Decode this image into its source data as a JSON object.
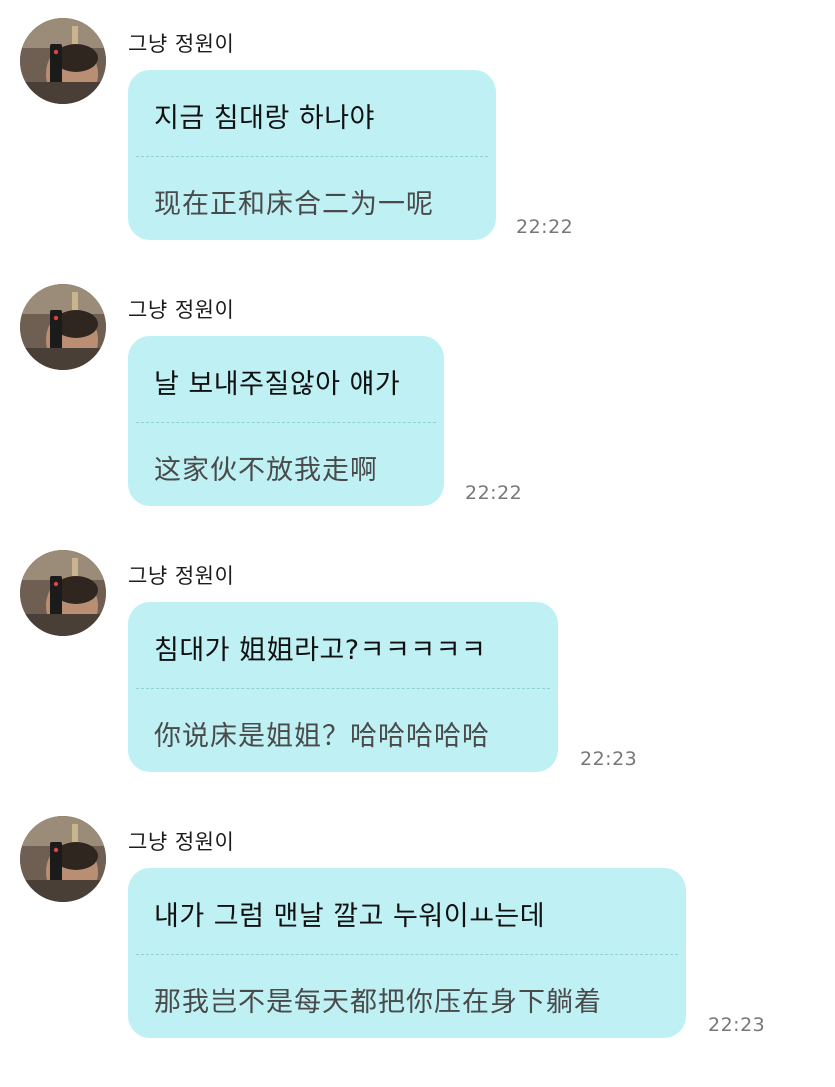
{
  "messages": [
    {
      "sender": "그냥 정원이",
      "text": "지금 침대랑 하나야",
      "translation": "现在正和床合二为一呢",
      "time": "22:22"
    },
    {
      "sender": "그냥 정원이",
      "text": "날 보내주질않아 얘가",
      "translation": "这家伙不放我走啊",
      "time": "22:22"
    },
    {
      "sender": "그냥 정원이",
      "text": "침대가 姐姐라고?ㅋㅋㅋㅋㅋ",
      "translation": "你说床是姐姐？哈哈哈哈哈",
      "time": "22:23"
    },
    {
      "sender": "그냥 정원이",
      "text": "내가 그럼 맨날 깔고 누워이ㅛ는데",
      "translation": "那我岂不是每天都把你压在身下躺着",
      "time": "22:23"
    }
  ],
  "colors": {
    "bubble": "#bff0f4",
    "divider": "#8fcfd6",
    "timestamp": "#777777"
  },
  "icons": {
    "avatar": "avatar-photo"
  }
}
